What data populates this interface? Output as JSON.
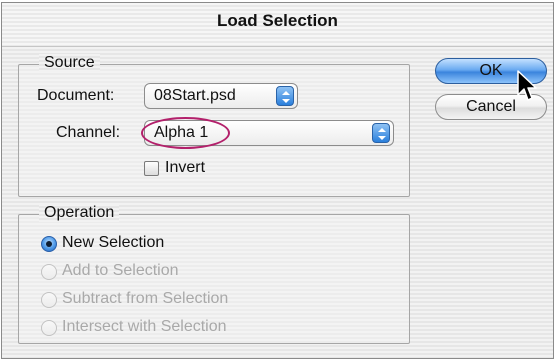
{
  "dialog": {
    "title": "Load Selection"
  },
  "source": {
    "label": "Source",
    "document_label": "Document:",
    "document_value": "08Start.psd",
    "channel_label": "Channel:",
    "channel_value": "Alpha 1",
    "invert_label": "Invert",
    "invert_checked": false
  },
  "operation": {
    "label": "Operation",
    "options": [
      {
        "label": "New Selection",
        "selected": true,
        "enabled": true
      },
      {
        "label": "Add to Selection",
        "selected": false,
        "enabled": false
      },
      {
        "label": "Subtract from Selection",
        "selected": false,
        "enabled": false
      },
      {
        "label": "Intersect with Selection",
        "selected": false,
        "enabled": false
      }
    ]
  },
  "buttons": {
    "ok": "OK",
    "cancel": "Cancel"
  },
  "colors": {
    "accent": "#3b84dd",
    "highlight": "#b3206b"
  },
  "icons": {
    "popup": "updown-arrows-icon",
    "cursor": "pointer-cursor-icon"
  }
}
